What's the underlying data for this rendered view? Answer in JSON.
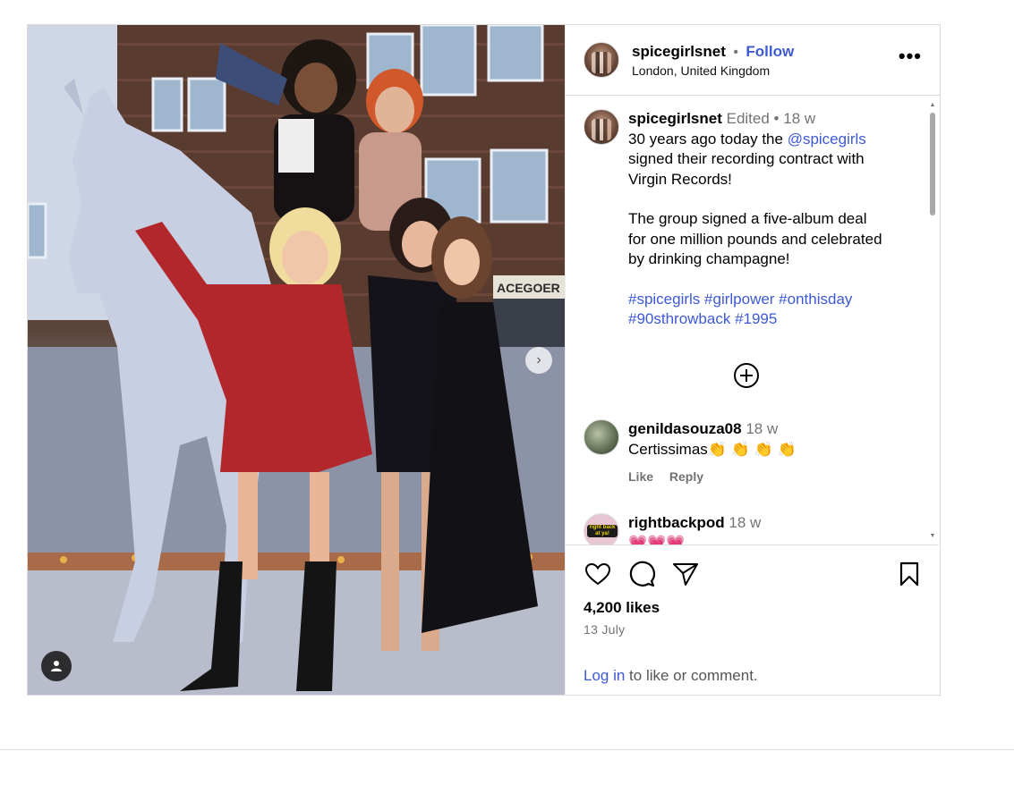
{
  "post": {
    "username": "spicegirlsnet",
    "follow_label": "Follow",
    "location": "London, United Kingdom",
    "more_label": "•••"
  },
  "caption": {
    "username": "spicegirlsnet",
    "edited_label": "Edited",
    "time": "18 w",
    "line1_pre": "30 years ago today the ",
    "mention": "@spicegirls",
    "line1_post": " signed their recording contract with Virgin Records!",
    "paragraph2": "The group signed a five-album deal for one million pounds and celebrated by drinking champagne!",
    "hashtags": "#spicegirls #girlpower #onthisday #90sthrowback #1995"
  },
  "comments": [
    {
      "username": "genildasouza08",
      "time": "18 w",
      "text": "Certissimas👏 👏 👏 👏",
      "like_label": "Like",
      "reply_label": "Reply"
    },
    {
      "username": "rightbackpod",
      "time": "18 w",
      "text": "💗💗💗",
      "avatar_text": "right back at ya!"
    }
  ],
  "footer": {
    "likes": "4,200 likes",
    "date": "13 July",
    "login_link": "Log in",
    "login_rest": " to like or comment."
  },
  "media": {
    "sign_text": "ACEGOER"
  },
  "colors": {
    "accent": "#3d59d6",
    "muted": "#737373",
    "border": "#dbdbdb"
  },
  "icons": [
    "heart-icon",
    "comment-icon",
    "share-icon",
    "bookmark-icon",
    "add-circle-icon",
    "user-tag-icon",
    "chevron-right-icon"
  ]
}
